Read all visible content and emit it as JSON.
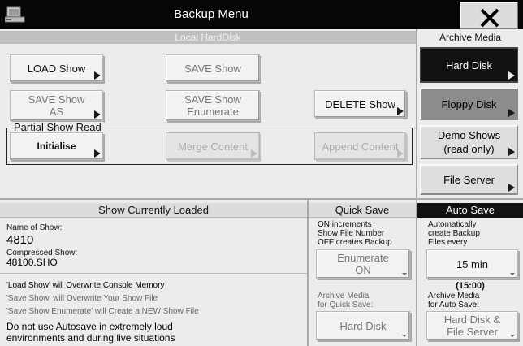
{
  "title": "Backup Menu",
  "close_label": "✕",
  "icons": {
    "app": "computer-icon",
    "close": "close-icon",
    "arrow": "arrow-right-icon"
  },
  "local": {
    "header": "Local HardDisk",
    "load_show": "LOAD Show",
    "save_show": "SAVE Show",
    "save_show_as": [
      "SAVE Show",
      "AS"
    ],
    "save_show_enumerate": [
      "SAVE Show",
      "Enumerate"
    ],
    "delete_show": "DELETE Show"
  },
  "partial": {
    "legend": "Partial Show Read",
    "initialise": "Initialise",
    "merge": "Merge Content",
    "append": "Append Content"
  },
  "archive": {
    "header": "Archive Media",
    "hard_disk": "Hard Disk",
    "floppy": "Floppy Disk",
    "demo": [
      "Demo Shows",
      "(read only)"
    ],
    "file_server": "File Server"
  },
  "loaded": {
    "header": "Show Currently Loaded",
    "name_label": "Name of Show:",
    "name_value": "4810",
    "compressed_label": "Compressed Show:",
    "compressed_value": "48100.SHO",
    "warn1": "'Load Show' will Overwrite Console Memory",
    "warn2": "'Save Show' will Overwrite Your Show File",
    "warn3": "'Save Show Enumerate' will Create a NEW Show File",
    "note": [
      "Do not use Autosave in extremely loud",
      "environments and during live situations"
    ]
  },
  "quick": {
    "header": "Quick Save",
    "desc": [
      "ON increments",
      "Show File Number",
      "OFF creates Backup"
    ],
    "enumerate": [
      "Enumerate",
      "ON"
    ],
    "archive_label": [
      "Archive Media",
      "for Quick Save:"
    ],
    "archive_value": "Hard Disk"
  },
  "auto": {
    "header": "Auto Save",
    "desc": [
      "Automatically",
      "create Backup",
      "Files every"
    ],
    "interval": "15 min",
    "next_time": "(15:00)",
    "archive_label": [
      "Archive Media",
      "for Auto Save:"
    ],
    "archive_value": [
      "Hard Disk &",
      "File Server"
    ]
  },
  "colors": {
    "title_bg": "#060606",
    "panel_bg": "#ececec",
    "header_bg": "#bfbfbf",
    "active_bg": "#111111"
  }
}
